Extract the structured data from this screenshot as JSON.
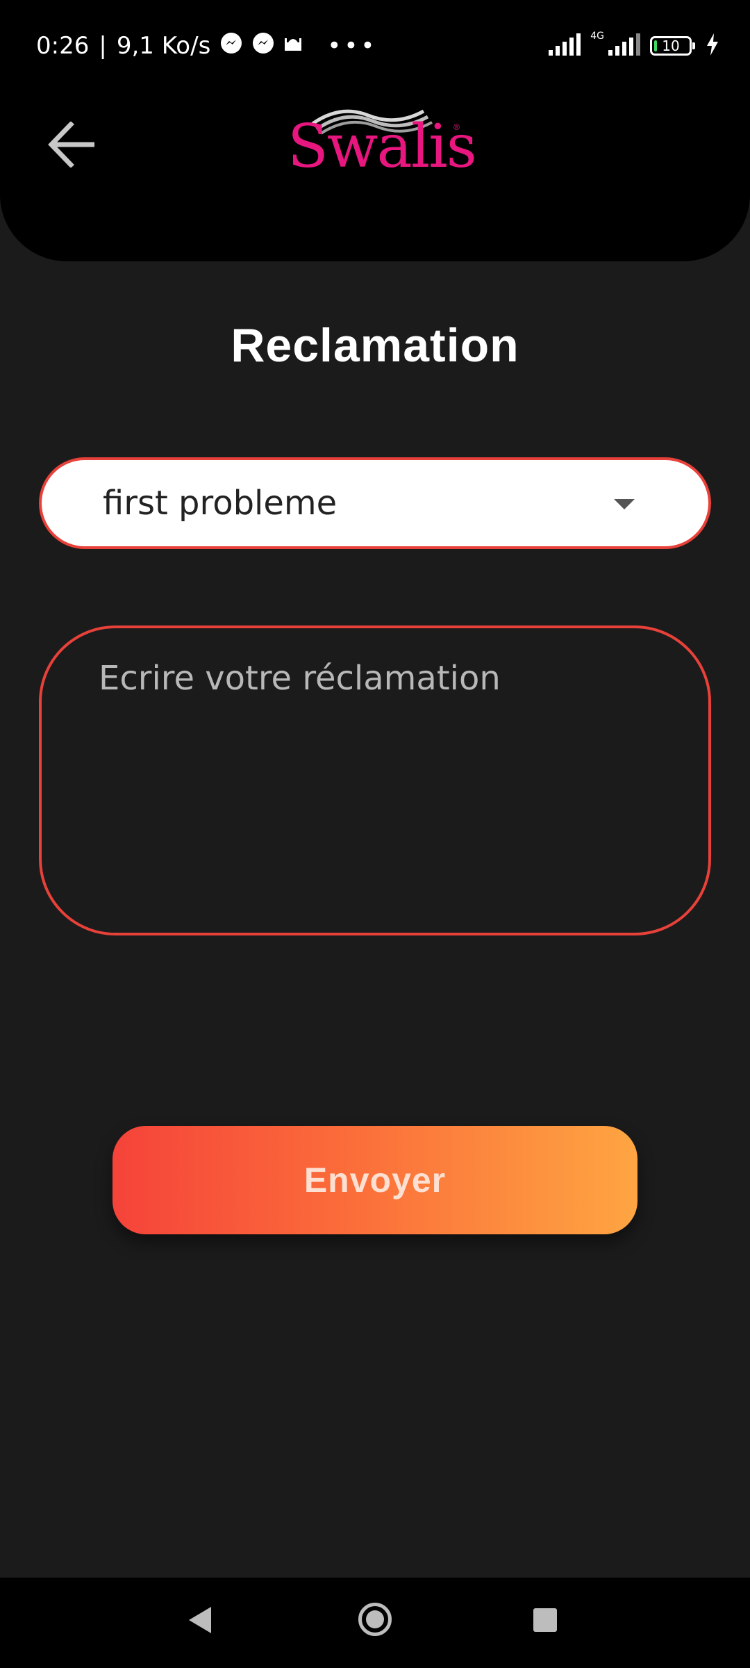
{
  "status_bar": {
    "time": "0:26",
    "separator": "|",
    "network_speed": "9,1 Ko/s",
    "overflow": "•••",
    "network_type": "4G",
    "battery_level": "10"
  },
  "header": {
    "logo_text": "Swalis",
    "logo_reg": "®"
  },
  "page": {
    "title": "Reclamation"
  },
  "form": {
    "problem_select_value": "first probleme",
    "reclamation_placeholder": "Ecrire votre réclamation",
    "submit_label": "Envoyer"
  },
  "colors": {
    "background": "#1b1b1b",
    "header": "#000000",
    "accent_border": "#e8413a",
    "logo": "#e8167f",
    "button_gradient_start": "#f5433a",
    "button_gradient_end": "#fea542"
  }
}
